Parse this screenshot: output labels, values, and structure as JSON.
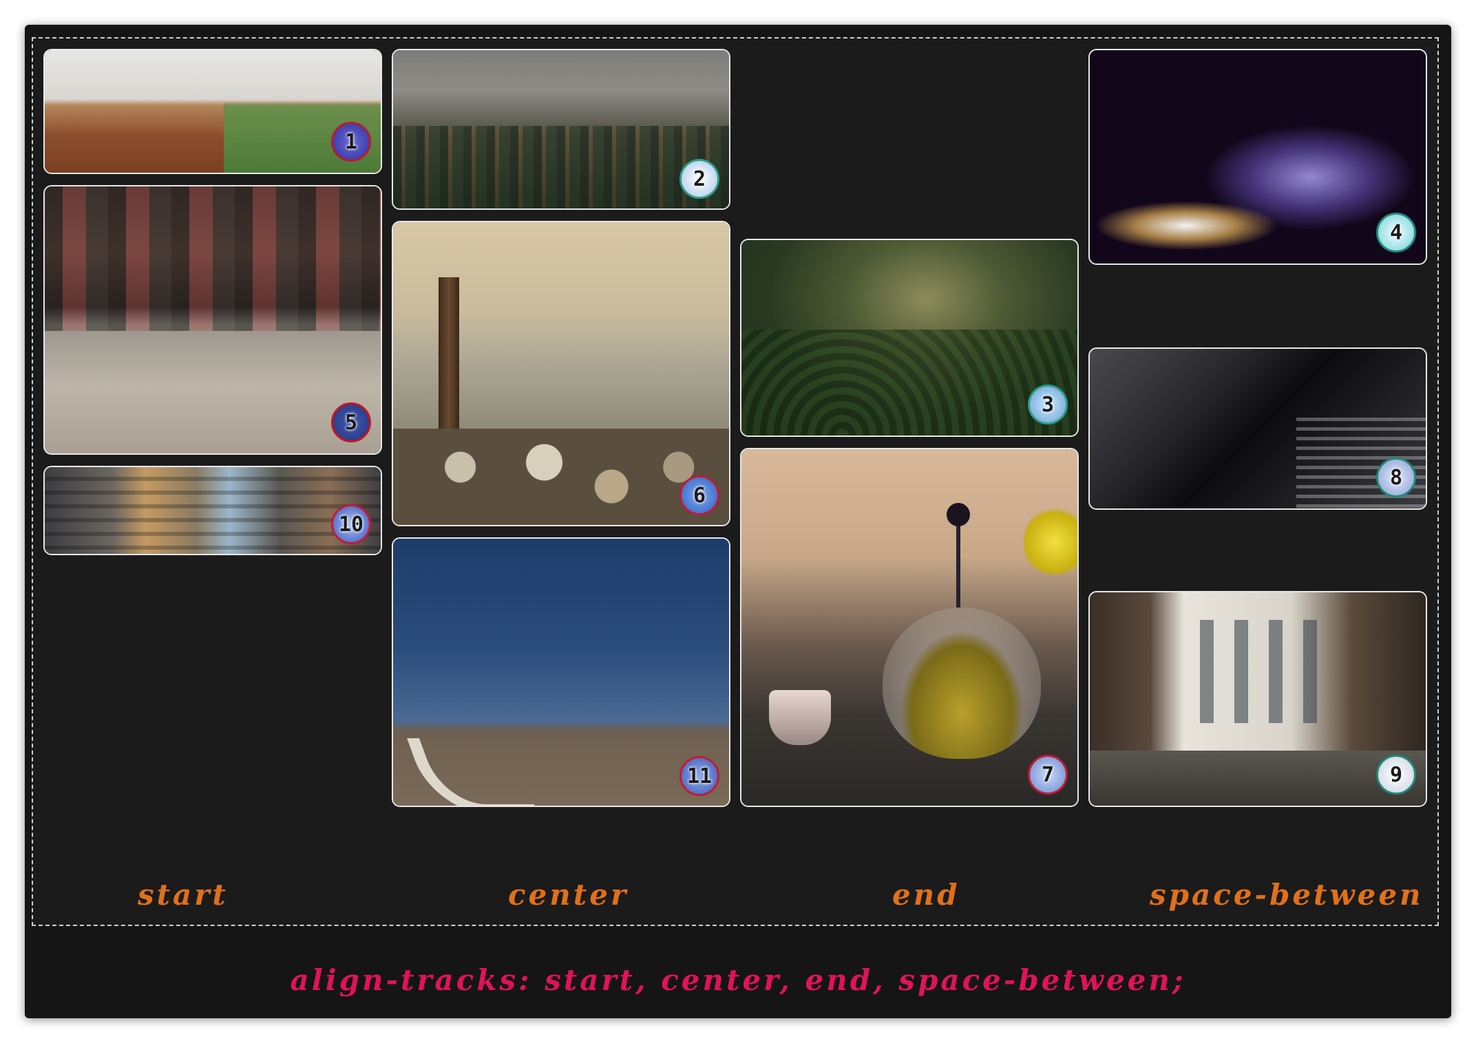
{
  "colors": {
    "background": "#151515",
    "label_orange": "#e0701a",
    "code_pink": "#e0125a",
    "card_border": "#e8e8e8"
  },
  "column_labels": [
    "start",
    "center",
    "end",
    "space-between"
  ],
  "css_declaration": "align-tracks: start, center, end, space-between;",
  "items": [
    {
      "number": "1",
      "subject": "field landscape"
    },
    {
      "number": "2",
      "subject": "misty forest"
    },
    {
      "number": "3",
      "subject": "foggy green hills"
    },
    {
      "number": "4",
      "subject": "smoke on dark background"
    },
    {
      "number": "5",
      "subject": "subway car floor"
    },
    {
      "number": "6",
      "subject": "wooden post and pebbles"
    },
    {
      "number": "7",
      "subject": "teapot with tea"
    },
    {
      "number": "8",
      "subject": "dark skyscrapers"
    },
    {
      "number": "9",
      "subject": "london street"
    },
    {
      "number": "10",
      "subject": "city buildings"
    },
    {
      "number": "11",
      "subject": "country road under blue sky"
    }
  ]
}
